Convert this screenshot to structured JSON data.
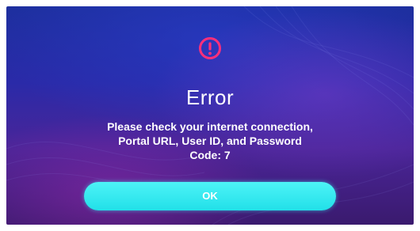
{
  "dialog": {
    "icon": "exclamation-circle-icon",
    "icon_color": "#ff2f7a",
    "title": "Error",
    "message_lines": [
      "Please check your internet connection,",
      "Portal URL, User ID, and Password",
      "Code: 7"
    ],
    "ok_label": "OK"
  },
  "colors": {
    "button": "#2ee6ec",
    "background_top": "#1d2f9e",
    "background_bottom": "#3a1a6e",
    "text": "#ffffff"
  }
}
